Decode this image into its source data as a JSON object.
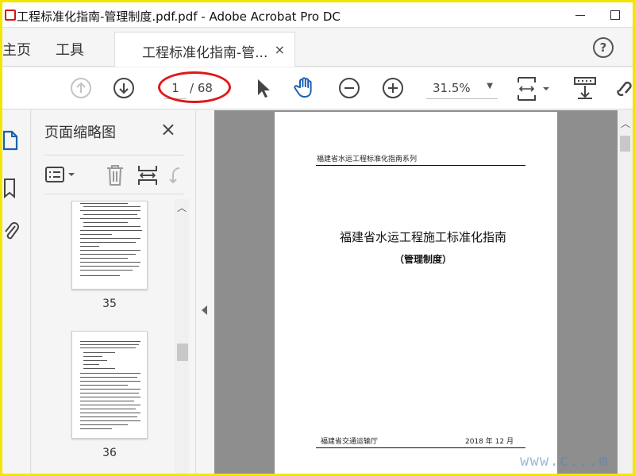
{
  "window": {
    "title": "工程标准化指南-管理制度.pdf.pdf - Adobe Acrobat Pro DC"
  },
  "menubar": {
    "home": "主页",
    "tools": "工具",
    "tab_label": "工程标准化指南-管...",
    "tab_close": "×",
    "help": "?"
  },
  "toolbar": {
    "current_page": "1",
    "total_pages": "/ 68",
    "zoom": "31.5%",
    "zoom_caret": "▼"
  },
  "thumbnails": {
    "title": "页面缩略图",
    "close": "×",
    "pages": [
      {
        "label": "35"
      },
      {
        "label": "36"
      }
    ]
  },
  "document": {
    "series": "福建省水运工程标准化指南系列",
    "title": "福建省水运工程施工标准化指南",
    "subtitle": "（管理制度）",
    "publisher": "福建省交通运输厅",
    "date": "2018 年 12 月"
  },
  "watermark": "www.c...m",
  "colors": {
    "frame": "#f2e600",
    "annotation": "#e01818",
    "active_icon": "#1a5fb4"
  }
}
